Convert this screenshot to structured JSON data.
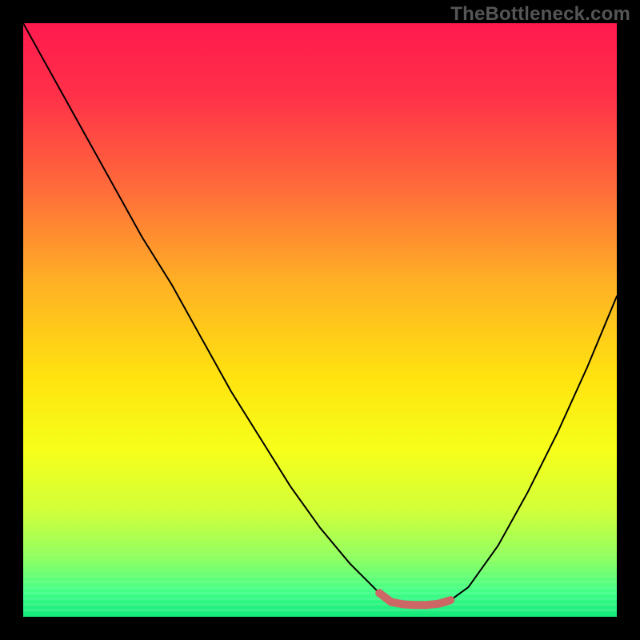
{
  "watermark": "TheBottleneck.com",
  "colors": {
    "frame": "#000000",
    "curve": "#000000",
    "marker": "#cc6766",
    "gradient_stops": [
      {
        "offset": 0.0,
        "color": "#ff1a4e"
      },
      {
        "offset": 0.12,
        "color": "#ff3049"
      },
      {
        "offset": 0.28,
        "color": "#ff6c3a"
      },
      {
        "offset": 0.44,
        "color": "#ffb224"
      },
      {
        "offset": 0.6,
        "color": "#ffe40f"
      },
      {
        "offset": 0.72,
        "color": "#f6ff1a"
      },
      {
        "offset": 0.82,
        "color": "#d2ff3a"
      },
      {
        "offset": 0.9,
        "color": "#90ff60"
      },
      {
        "offset": 0.96,
        "color": "#40ff88"
      },
      {
        "offset": 1.0,
        "color": "#12e87a"
      }
    ]
  },
  "chart_data": {
    "type": "line",
    "title": "",
    "xlabel": "",
    "ylabel": "",
    "xlim": [
      0,
      100
    ],
    "ylim": [
      0,
      100
    ],
    "series": [
      {
        "name": "bottleneck-curve",
        "x": [
          0,
          5,
          10,
          15,
          20,
          25,
          30,
          35,
          40,
          45,
          50,
          55,
          60,
          62,
          65,
          68,
          70,
          72,
          75,
          80,
          85,
          90,
          95,
          100
        ],
        "y": [
          100,
          91,
          82,
          73,
          64,
          56,
          47,
          38,
          30,
          22,
          15,
          9,
          4,
          2.5,
          2,
          2,
          2.2,
          2.8,
          5,
          12,
          21,
          31,
          42,
          54
        ]
      }
    ],
    "markers": {
      "name": "minimum-band",
      "x": [
        60,
        62,
        64,
        66,
        68,
        70,
        72
      ],
      "y": [
        4,
        2.5,
        2.1,
        2.0,
        2.0,
        2.2,
        2.8
      ]
    }
  }
}
